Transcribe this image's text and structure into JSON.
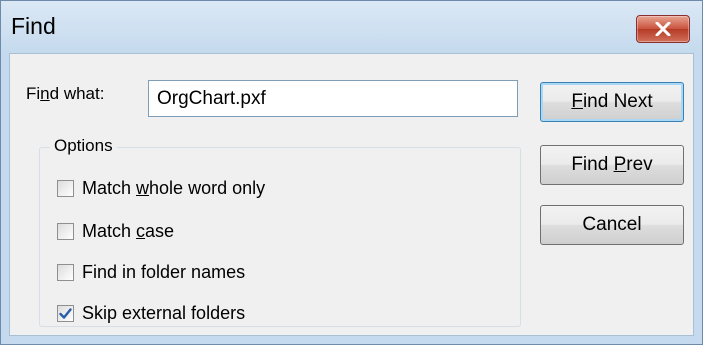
{
  "window": {
    "title": "Find"
  },
  "find": {
    "label_pre": "Fi",
    "label_u": "n",
    "label_post": "d what:",
    "value": "OrgChart.pxf"
  },
  "options": {
    "legend": "Options",
    "items": [
      {
        "pre": "Match ",
        "u": "w",
        "post": "hole word only",
        "checked": false
      },
      {
        "pre": "Match ",
        "u": "c",
        "post": "ase",
        "checked": false
      },
      {
        "pre": "Find in folder names",
        "u": "",
        "post": "",
        "checked": false
      },
      {
        "pre": "Skip external folders",
        "u": "",
        "post": "",
        "checked": true
      }
    ]
  },
  "buttons": {
    "find_next": {
      "u": "F",
      "post": "ind Next"
    },
    "find_prev": {
      "pre": "Find ",
      "u": "P",
      "post": "rev"
    },
    "cancel": {
      "label": "Cancel"
    }
  },
  "colors": {
    "close": "#c8523d",
    "check": "#2a5ea8"
  },
  "icons": {
    "close": "close-icon",
    "check": "checkmark-icon"
  }
}
